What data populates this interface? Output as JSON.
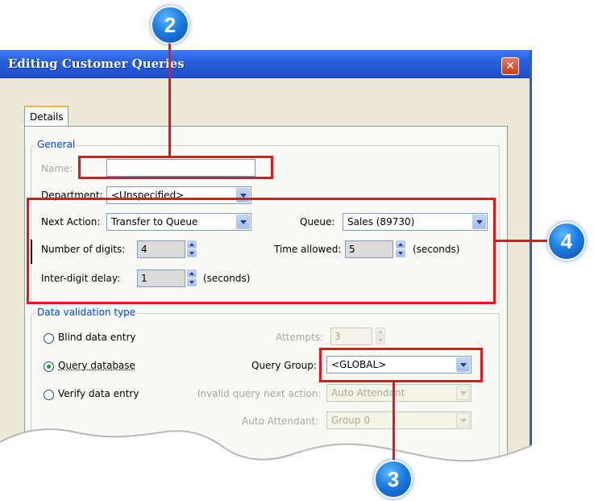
{
  "window": {
    "title": "Editing Customer Queries",
    "close_glyph": "✕"
  },
  "tabs": [
    {
      "label": "Details"
    }
  ],
  "general": {
    "legend": "General",
    "name_label": "Name:",
    "name_value": "",
    "department_label": "Department:",
    "department_value": "<Unspecified>",
    "next_action_label": "Next Action:",
    "next_action_value": "Transfer to Queue",
    "queue_label": "Queue:",
    "queue_value": "Sales (89730)",
    "num_digits_label": "Number of digits:",
    "num_digits_value": "4",
    "time_allowed_label": "Time allowed:",
    "time_allowed_value": "5",
    "seconds_label_1": "(seconds)",
    "inter_digit_label": "Inter-digit delay:",
    "inter_digit_value": "1",
    "seconds_label_2": "(seconds)"
  },
  "validation": {
    "legend": "Data validation type",
    "blind_label": "Blind data entry",
    "query_label": "Query database",
    "verify_label": "Verify data entry",
    "selected": "query",
    "attempts_label": "Attempts:",
    "attempts_value": "3",
    "query_group_label": "Query Group:",
    "query_group_value": "<GLOBAL>",
    "invalid_next_label": "Invalid query next action:",
    "invalid_next_value": "Auto Attendant",
    "auto_attendant_label": "Auto Attendant:",
    "auto_attendant_value": "Group 0"
  },
  "callouts": [
    "2",
    "3",
    "4"
  ],
  "colors": {
    "title_bar": "#2a61de",
    "callout_red": "#e8141f",
    "badge_blue": "#1d7de0",
    "legend_blue": "#0046d5"
  }
}
